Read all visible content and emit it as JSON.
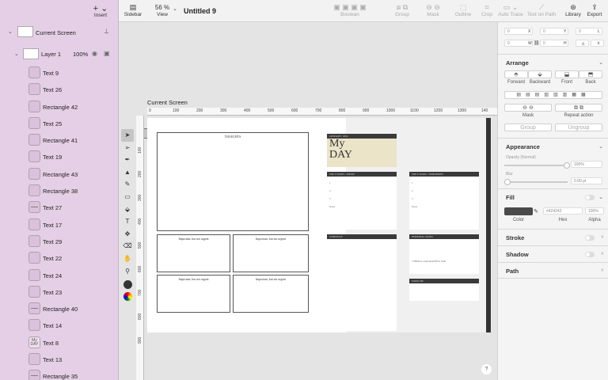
{
  "sidebar": {
    "insert_label": "Insert",
    "screen_label": "Current Screen",
    "layer_label": "Layer 1",
    "layer_opacity": "100%",
    "items": [
      {
        "label": "Text 9",
        "icon": "text"
      },
      {
        "label": "Text 26",
        "icon": "text"
      },
      {
        "label": "Rectangle 42",
        "icon": "rect"
      },
      {
        "label": "Text 25",
        "icon": "text"
      },
      {
        "label": "Rectangle 41",
        "icon": "rect"
      },
      {
        "label": "Text 19",
        "icon": "text"
      },
      {
        "label": "Rectangle 43",
        "icon": "rect"
      },
      {
        "label": "Rectangle 38",
        "icon": "rect"
      },
      {
        "label": "Text 27",
        "icon": "line"
      },
      {
        "label": "Text 17",
        "icon": "text"
      },
      {
        "label": "Text 29",
        "icon": "text"
      },
      {
        "label": "Text 22",
        "icon": "text"
      },
      {
        "label": "Text 24",
        "icon": "text"
      },
      {
        "label": "Text 23",
        "icon": "text"
      },
      {
        "label": "Rectangle 40",
        "icon": "line"
      },
      {
        "label": "Text 14",
        "icon": "text"
      },
      {
        "label": "Text 8",
        "icon": "day"
      },
      {
        "label": "Text 13",
        "icon": "text"
      },
      {
        "label": "Rectangle 35",
        "icon": "line"
      }
    ]
  },
  "toolbar": {
    "sidebar_label": "Sidebar",
    "zoom": "56 %",
    "view_label": "View",
    "doc_title": "Untitled 9",
    "boolean_label": "Boolean",
    "group_label": "Group",
    "mask_label": "Mask",
    "outline_label": "Outline",
    "crop_label": "Crop",
    "autotrace_label": "Auto Trace",
    "textonpath_label": "Text on Path",
    "library_label": "Library",
    "export_label": "Export"
  },
  "canvas": {
    "screen_label": "Current Screen",
    "ruler_h": [
      "0",
      "100",
      "200",
      "300",
      "400",
      "500",
      "600",
      "700",
      "800",
      "900",
      "1000",
      "1100",
      "1200",
      "1300",
      "140"
    ],
    "ruler_v": [
      "100",
      "200",
      "300",
      "400",
      "500",
      "600",
      "700",
      "800",
      "900"
    ],
    "thoughts": "THOUGHTS",
    "quad_labels": [
      "Important, but not urgent",
      "Important, but not urgent",
      "Important, but not urgent",
      "Important, but not urgent"
    ],
    "day_header": "JANUARY / 2024",
    "day_big1": "My",
    "day_big2": "DAY",
    "top3_today": "TOP 3 TASKS / TODAY",
    "top3_tomorrow": "TOP 3 TASKS / TOMORROW",
    "notes": "Notes",
    "schedule": "SCHEDULE",
    "personal": "PERSONAL TASKS",
    "grateful": "3 THINGS I AM GRATEFUL FOR",
    "exercise": "EXERCISE"
  },
  "right_panel": {
    "x_label": "X",
    "y_label": "Y",
    "w_label": "W",
    "h_label": "H",
    "l_label": "L",
    "x_val": "0",
    "y_val": "0",
    "w_val": "0",
    "h_val": "0",
    "l_val": "0",
    "arrange_title": "Arrange",
    "forward": "Forward",
    "backward": "Backward",
    "front": "Front",
    "back": "Back",
    "mask": "Mask",
    "repeat_action": "Repeat action",
    "group": "Group",
    "ungroup": "Ungroup",
    "appearance_title": "Appearance",
    "opacity_label": "Opacity (Normal)",
    "opacity_val": "100%",
    "blur_label": "Blur",
    "blur_val": "0.00 pt",
    "fill_title": "Fill",
    "hex_val": "#424242",
    "alpha_val": "100%",
    "color_label": "Color",
    "hex_label": "Hex",
    "alpha_label": "Alpha",
    "stroke_title": "Stroke",
    "shadow_title": "Shadow",
    "path_title": "Path",
    "fill_color": "#4a4a4a"
  },
  "help_label": "?"
}
